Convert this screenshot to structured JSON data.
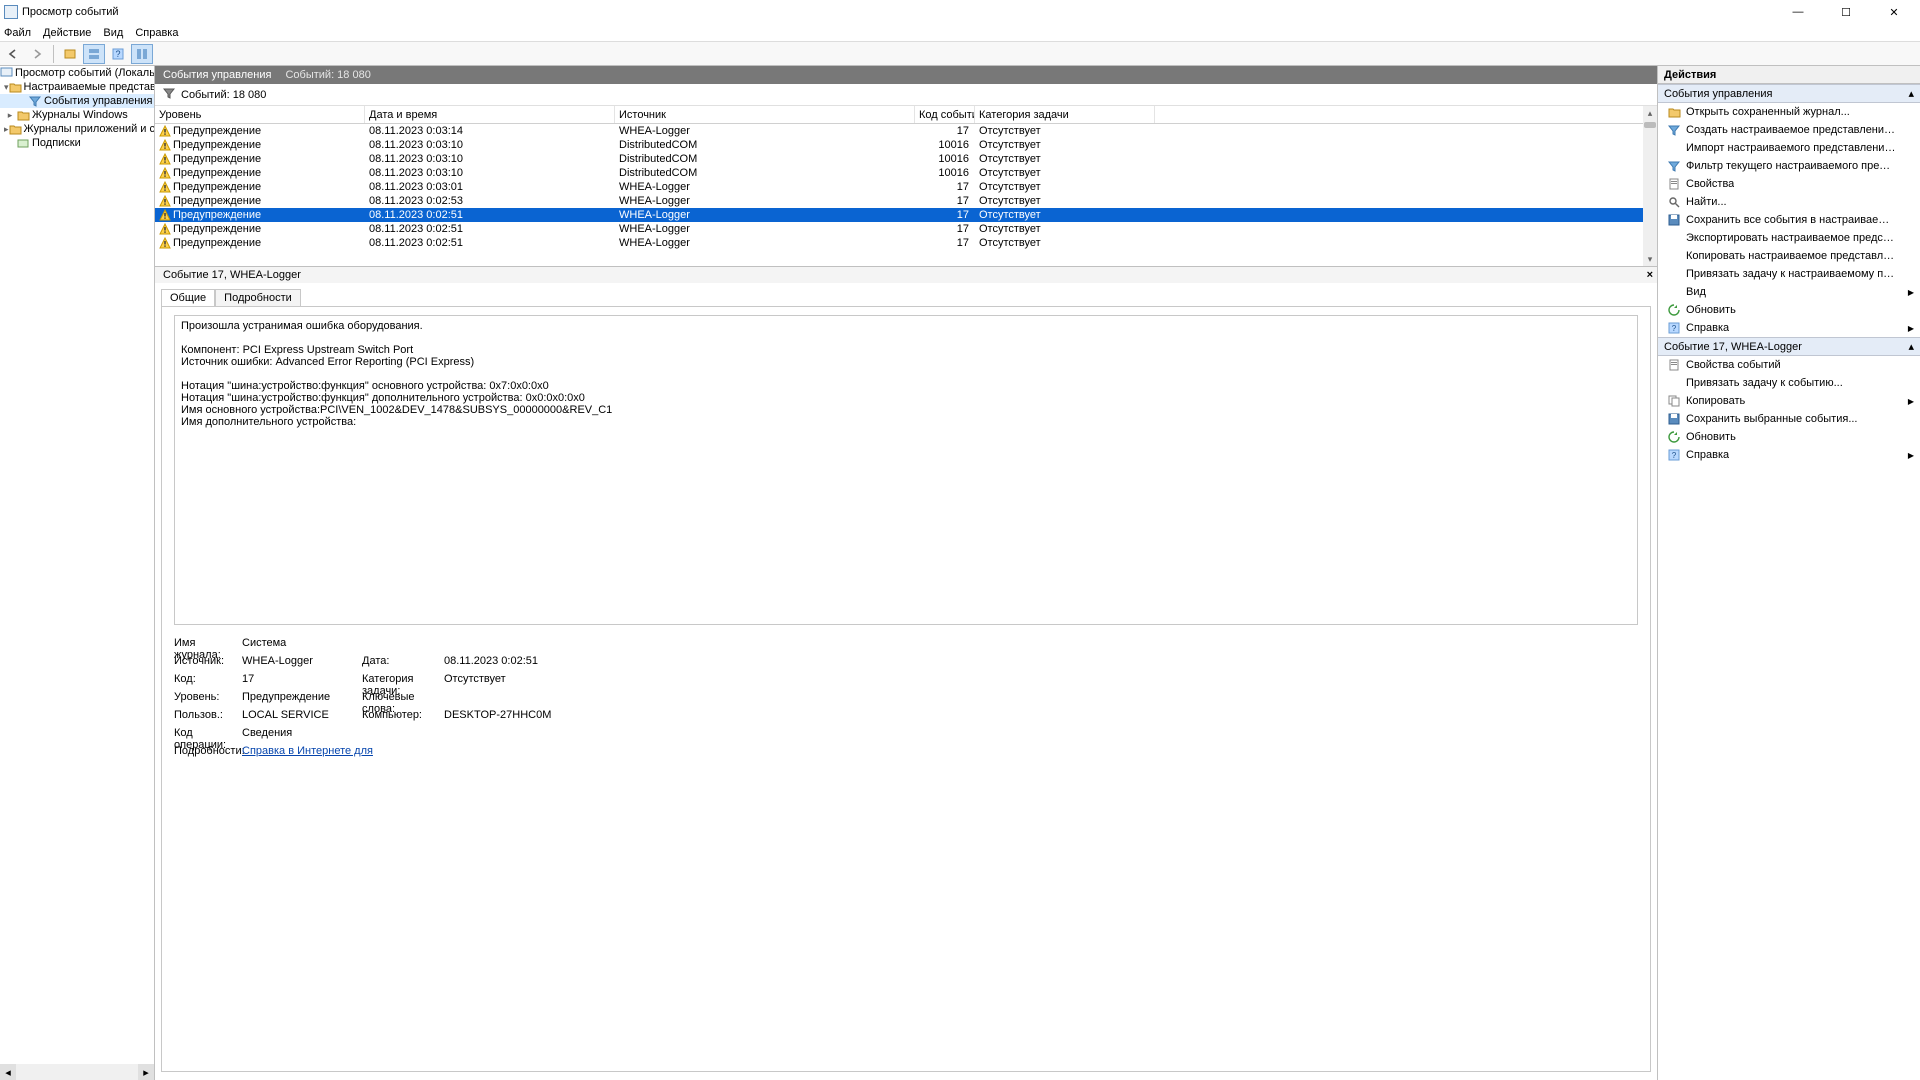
{
  "window_title": "Просмотр событий",
  "menus": [
    "Файл",
    "Действие",
    "Вид",
    "Справка"
  ],
  "tree": {
    "root": "Просмотр событий (Локальный)",
    "custom_views": "Настраиваемые представления",
    "admin_events": "События управления",
    "win_logs": "Журналы Windows",
    "app_logs": "Журналы приложений и служб",
    "subscriptions": "Подписки"
  },
  "center_header": {
    "title": "События управления",
    "count_label": "Событий: 18 080"
  },
  "filter_bar": {
    "count": "Событий: 18 080"
  },
  "columns": {
    "level": "Уровень",
    "date": "Дата и время",
    "source": "Источник",
    "code": "Код события",
    "task": "Категория задачи"
  },
  "level_label": "Предупреждение",
  "task_label": "Отсутствует",
  "events": [
    {
      "date": "08.11.2023 0:03:14",
      "source": "WHEA-Logger",
      "code": "17",
      "selected": false
    },
    {
      "date": "08.11.2023 0:03:10",
      "source": "DistributedCOM",
      "code": "10016",
      "selected": false
    },
    {
      "date": "08.11.2023 0:03:10",
      "source": "DistributedCOM",
      "code": "10016",
      "selected": false
    },
    {
      "date": "08.11.2023 0:03:10",
      "source": "DistributedCOM",
      "code": "10016",
      "selected": false
    },
    {
      "date": "08.11.2023 0:03:01",
      "source": "WHEA-Logger",
      "code": "17",
      "selected": false
    },
    {
      "date": "08.11.2023 0:02:53",
      "source": "WHEA-Logger",
      "code": "17",
      "selected": false
    },
    {
      "date": "08.11.2023 0:02:51",
      "source": "WHEA-Logger",
      "code": "17",
      "selected": true
    },
    {
      "date": "08.11.2023 0:02:51",
      "source": "WHEA-Logger",
      "code": "17",
      "selected": false
    },
    {
      "date": "08.11.2023 0:02:51",
      "source": "WHEA-Logger",
      "code": "17",
      "selected": false
    }
  ],
  "preview": {
    "title": "Событие 17, WHEA-Logger",
    "tab_general": "Общие",
    "tab_details": "Подробности",
    "description": "Произошла устранимая ошибка оборудования.\n\nКомпонент: PCI Express Upstream Switch Port\nИсточник ошибки: Advanced Error Reporting (PCI Express)\n\nНотация \"шина:устройство:функция\" основного устройства: 0x7:0x0:0x0\nНотация \"шина:устройство:функция\" дополнительного устройства: 0x0:0x0:0x0\nИмя основного устройства:PCI\\VEN_1002&DEV_1478&SUBSYS_00000000&REV_C1\nИмя дополнительного устройства:",
    "labels": {
      "log_name": "Имя журнала:",
      "source": "Источник:",
      "event_id": "Код:",
      "level": "Уровень:",
      "user": "Пользов.:",
      "opcode": "Код операции:",
      "more_info": "Подробности:",
      "date": "Дата:",
      "task_cat": "Категория задачи:",
      "keywords": "Ключевые слова:",
      "computer": "Компьютер:"
    },
    "values": {
      "log_name": "Система",
      "source": "WHEA-Logger",
      "event_id": "17",
      "level": "Предупреждение",
      "user": "LOCAL SERVICE",
      "opcode": "Сведения",
      "date": "08.11.2023 0:02:51",
      "task_cat": "Отсутствует",
      "keywords": "",
      "computer": "DESKTOP-27HHC0M",
      "more_info_link": "Справка в Интернете для "
    }
  },
  "actions_pane": {
    "title": "Действия",
    "section1": "События управления",
    "items1": [
      "Открыть сохраненный журнал...",
      "Создать настраиваемое представление...",
      "Импорт настраиваемого представления...",
      "Фильтр текущего настраиваемого представления...",
      "Свойства",
      "Найти...",
      "Сохранить все события в настраиваемом представл...",
      "Экспортировать настраиваемое представление...",
      "Копировать настраиваемое представление...",
      "Привязать задачу к настраиваемому представлени..."
    ],
    "view_item": "Вид",
    "refresh": "Обновить",
    "help": "Справка",
    "section2": "Событие 17, WHEA-Logger",
    "items2": [
      "Свойства событий",
      "Привязать задачу к событию...",
      "Копировать",
      "Сохранить выбранные события...",
      "Обновить",
      "Справка"
    ]
  }
}
